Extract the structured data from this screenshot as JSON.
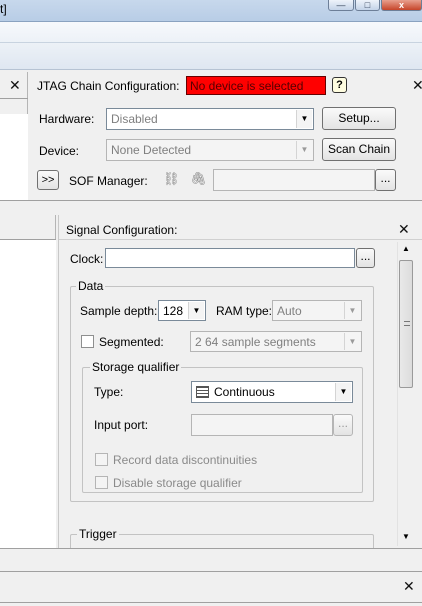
{
  "window": {
    "title_fragment": "t]",
    "minimize_glyph": "—",
    "maximize_glyph": "□",
    "close_glyph": "x"
  },
  "jtag": {
    "title": "JTAG Chain Configuration:",
    "status": "No device is selected",
    "status_color": "#ff0000",
    "help_glyph": "?",
    "hardware_label": "Hardware:",
    "hardware_value": "Disabled",
    "setup_label": "Setup...",
    "device_label": "Device:",
    "device_value": "None Detected",
    "scan_chain_label": "Scan Chain",
    "expand_label": ">>",
    "sof_label": "SOF Manager:",
    "browse_label": "..."
  },
  "signal": {
    "title": "Signal Configuration:",
    "clock_label": "Clock:",
    "clock_value": "",
    "clock_browse": "...",
    "data_group": "Data",
    "sample_depth_label": "Sample depth:",
    "sample_depth_value": "128",
    "ram_type_label": "RAM type:",
    "ram_type_value": "Auto",
    "segmented_label": "Segmented:",
    "segments_value": "2  64 sample segments",
    "storage_group": "Storage qualifier",
    "type_label": "Type:",
    "type_value": "Continuous",
    "input_port_label": "Input port:",
    "input_port_browse": "...",
    "record_label": "Record data discontinuities",
    "disable_label": "Disable storage qualifier",
    "trigger_group": "Trigger"
  },
  "close_glyph": "✕",
  "icons": {
    "tag_glyph": "⛓",
    "clip_glyph": "🖇"
  }
}
